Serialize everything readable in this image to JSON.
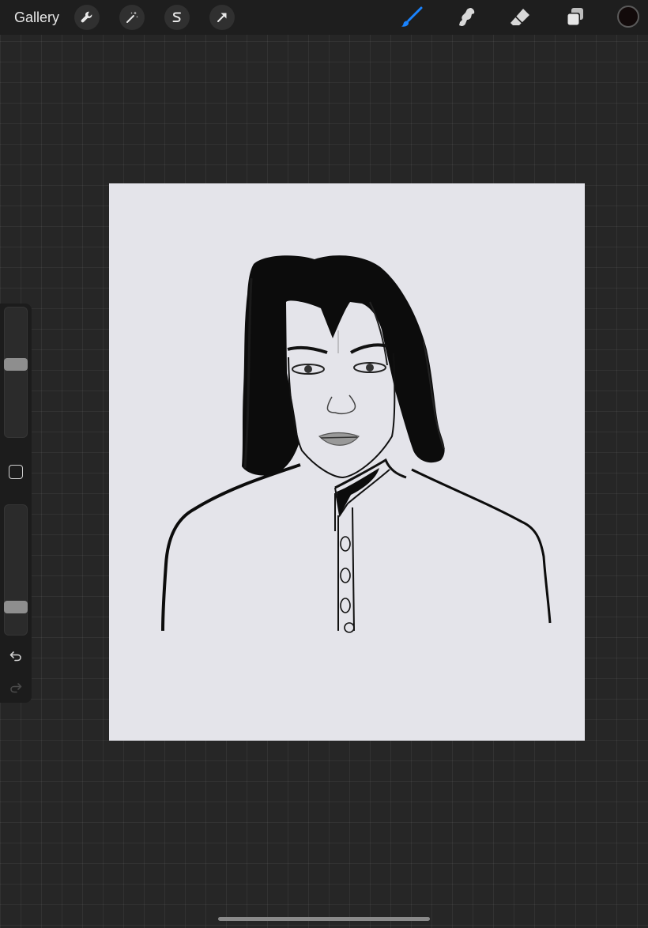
{
  "toolbar": {
    "gallery_label": "Gallery",
    "left_tools": [
      {
        "icon": "wrench-icon",
        "name": "actions"
      },
      {
        "icon": "magic-wand-icon",
        "name": "adjustments"
      },
      {
        "icon": "selection-s-icon",
        "name": "selection"
      },
      {
        "icon": "arrow-cursor-icon",
        "name": "transform"
      }
    ],
    "right_tools": [
      {
        "icon": "brush-icon",
        "name": "brush",
        "active": true
      },
      {
        "icon": "smudge-icon",
        "name": "smudge",
        "active": false
      },
      {
        "icon": "eraser-icon",
        "name": "eraser",
        "active": false
      },
      {
        "icon": "layers-icon",
        "name": "layers",
        "active": false
      }
    ],
    "current_color": "#120a0a"
  },
  "colors": {
    "accent": "#1a84ff",
    "canvas_background": "#e4e4ea",
    "workspace_background": "#262626"
  },
  "sidebar": {
    "brush_size_level": 0.57,
    "opacity_level": 0.17,
    "modify_icon": "modify-square-icon",
    "undo_icon": "undo-icon",
    "redo_icon": "redo-icon",
    "redo_enabled": false
  },
  "canvas": {
    "artwork": "ink-portrait-drawing"
  }
}
